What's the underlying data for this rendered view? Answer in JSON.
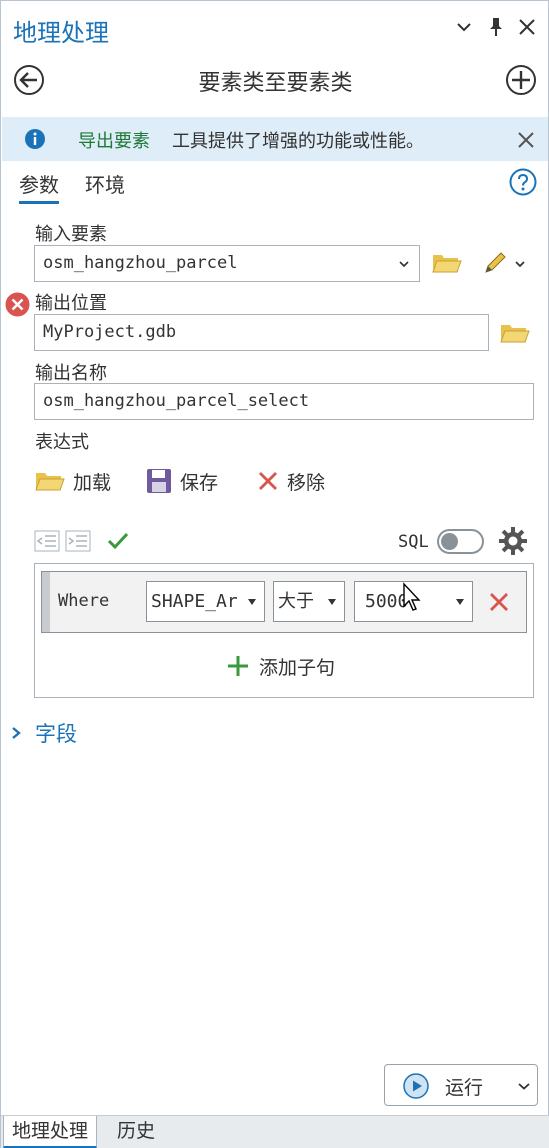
{
  "window": {
    "title": "地理处理"
  },
  "tool": {
    "title": "要素类至要素类"
  },
  "banner": {
    "link": "导出要素",
    "text": "工具提供了增强的功能或性能。"
  },
  "tabs": [
    {
      "label": "参数",
      "active": true
    },
    {
      "label": "环境",
      "active": false
    }
  ],
  "params": {
    "input_label": "输入要素",
    "input_value": "osm_hangzhou_parcel",
    "output_location_label": "输出位置",
    "output_location_value": "MyProject.gdb",
    "output_name_label": "输出名称",
    "output_name_value": "osm_hangzhou_parcel_select",
    "expression_label": "表达式"
  },
  "expression": {
    "load": "加载",
    "save": "保存",
    "remove": "移除",
    "sql_label": "SQL",
    "sql_enabled": false,
    "clause": {
      "keyword": "Where",
      "field": "SHAPE_Ar",
      "operator": "大于",
      "value": "5000"
    },
    "add_clause": "添加子句"
  },
  "fields_section": "字段",
  "run": {
    "label": "运行"
  },
  "bottom_tabs": [
    {
      "label": "地理处理",
      "active": true
    },
    {
      "label": "历史",
      "active": false
    }
  ],
  "colors": {
    "accent": "#1a73b8",
    "error": "#d9534f",
    "banner_bg": "#deedf7",
    "link_green": "#1e7a3a",
    "folder_yellow": "#e8c24a"
  }
}
